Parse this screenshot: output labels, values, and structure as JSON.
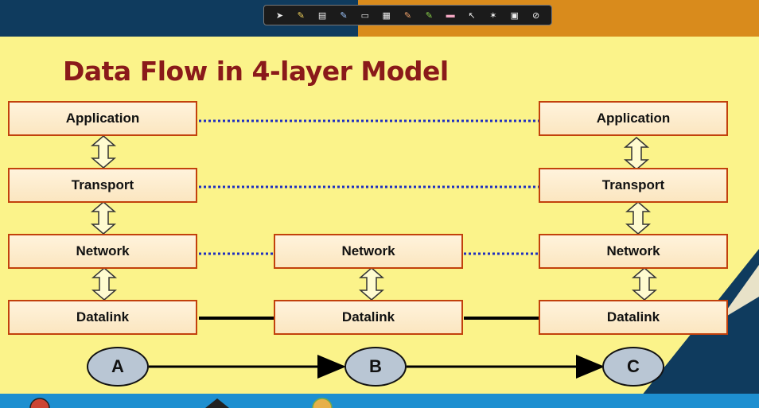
{
  "title": "Data Flow in 4-layer Model",
  "colors": {
    "title": "#8a1a1a",
    "background": "#fbf38a",
    "header_left": "#0f3b5e",
    "header_right": "#d98b1c",
    "box_border": "#c2410c",
    "box_fill": "#fde9c8",
    "dotted_link": "#1f2fbf",
    "solid_link": "#000000",
    "node_fill": "#b9c6d4"
  },
  "toolbar": {
    "icons": [
      "pointer-icon",
      "pen-icon",
      "page-icon",
      "marker-icon",
      "highlighter-icon",
      "screen-icon",
      "pencil-icon",
      "green-marker-icon",
      "eraser-icon",
      "cursor-icon",
      "laser-icon",
      "clear-icon",
      "close-icon"
    ]
  },
  "stacks": {
    "A": {
      "layers": [
        "Application",
        "Transport",
        "Network",
        "Datalink"
      ]
    },
    "B": {
      "layers": [
        "Network",
        "Datalink"
      ]
    },
    "C": {
      "layers": [
        "Application",
        "Transport",
        "Network",
        "Datalink"
      ]
    }
  },
  "nodes": [
    "A",
    "B",
    "C"
  ]
}
